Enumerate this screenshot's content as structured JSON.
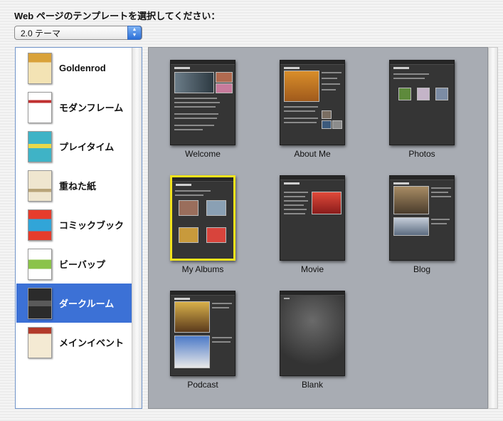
{
  "prompt": "Web ページのテンプレートを選択してください：",
  "theme_select": {
    "value": "2.0 テーマ"
  },
  "themes": [
    {
      "label": "Goldenrod",
      "selected": false,
      "thumb_colors": [
        "#d9a23a",
        "#f3e3b4"
      ]
    },
    {
      "label": "モダンフレーム",
      "selected": false,
      "thumb_colors": [
        "#ffffff",
        "#c03030"
      ]
    },
    {
      "label": "プレイタイム",
      "selected": false,
      "thumb_colors": [
        "#3fb3c6",
        "#e8d84a"
      ]
    },
    {
      "label": "重ねた紙",
      "selected": false,
      "thumb_colors": [
        "#efe6cf",
        "#b8a478"
      ]
    },
    {
      "label": "コミックブック",
      "selected": false,
      "thumb_colors": [
        "#e63c2c",
        "#31a5d8"
      ]
    },
    {
      "label": "ビーバップ",
      "selected": false,
      "thumb_colors": [
        "#ffffff",
        "#8bc34a"
      ]
    },
    {
      "label": "ダークルーム",
      "selected": true,
      "thumb_colors": [
        "#2b2b2b",
        "#5a5a5a"
      ]
    },
    {
      "label": "メインイベント",
      "selected": false,
      "thumb_colors": [
        "#f4ead3",
        "#b23a2a"
      ]
    }
  ],
  "templates": [
    {
      "label": "Welcome",
      "selected": false
    },
    {
      "label": "About Me",
      "selected": false
    },
    {
      "label": "Photos",
      "selected": false
    },
    {
      "label": "My Albums",
      "selected": true
    },
    {
      "label": "Movie",
      "selected": false
    },
    {
      "label": "Blog",
      "selected": false
    },
    {
      "label": "Podcast",
      "selected": false
    },
    {
      "label": "Blank",
      "selected": false
    }
  ],
  "colors": {
    "selection": "#3c71d6",
    "template_highlight": "#f2e31c",
    "gallery_background": "#a8acb3"
  }
}
